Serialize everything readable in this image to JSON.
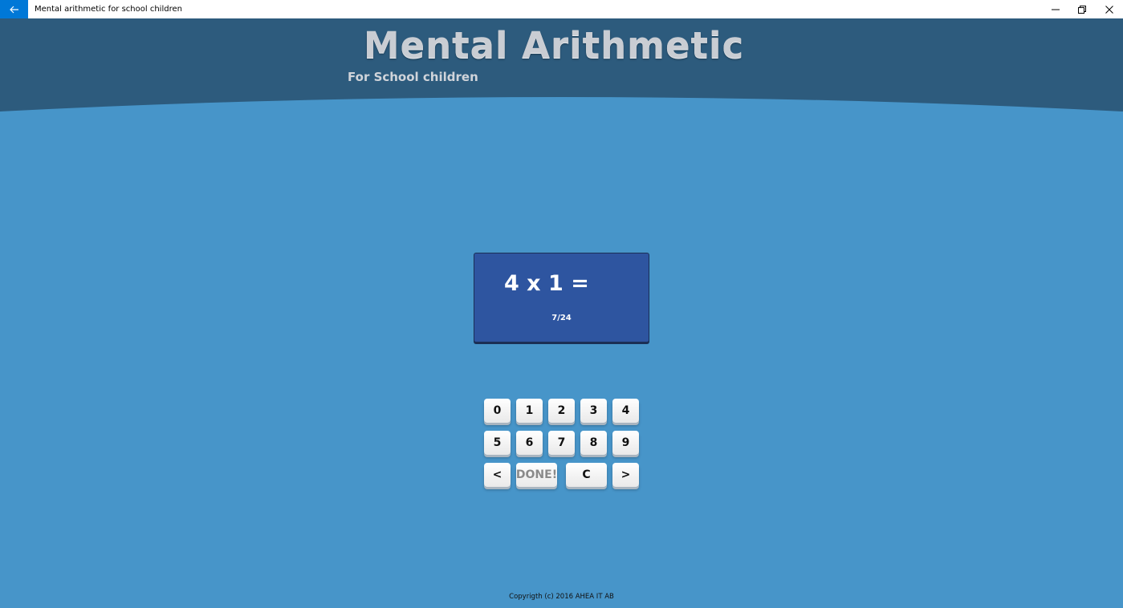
{
  "window": {
    "title": "Mental arithmetic for school children",
    "back_icon": "arrow-left-icon",
    "controls": [
      "minimize-icon",
      "restore-icon",
      "close-icon"
    ]
  },
  "header": {
    "title": "Mental Arithmetic",
    "subtitle": "For School children"
  },
  "question": {
    "expression": "4 x 1 =",
    "progress": "7/24"
  },
  "keypad": {
    "row1": [
      "0",
      "1",
      "2",
      "3",
      "4"
    ],
    "row2": [
      "5",
      "6",
      "7",
      "8",
      "9"
    ],
    "prev": "<",
    "done": "DONE!",
    "clear": "C",
    "next": ">"
  },
  "footer": {
    "copyright": "Copyrigth (c) 2016 AHEA IT AB"
  },
  "colors": {
    "background": "#4795c9",
    "header": "#2d5b7d",
    "card": "#2e55a0",
    "accent": "#0078d7"
  }
}
